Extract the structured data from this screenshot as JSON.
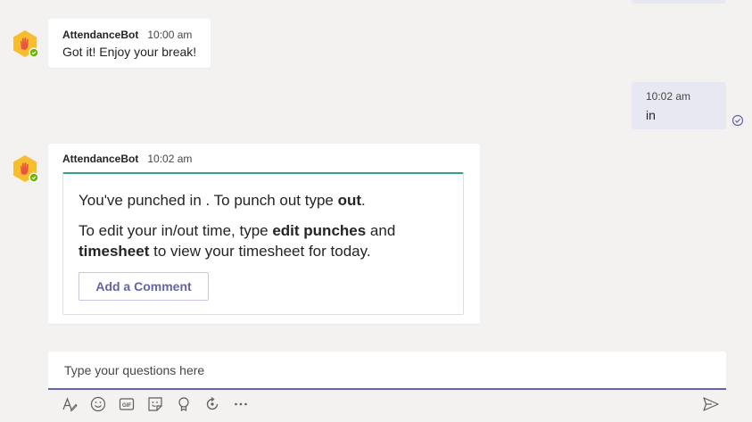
{
  "messages": [
    {
      "sender": "AttendanceBot",
      "time": "10:00 am",
      "text": "Got it! Enjoy your break!"
    },
    {
      "time": "10:02 am",
      "text": "in"
    },
    {
      "sender": "AttendanceBot",
      "time": "10:02 am",
      "card": {
        "line1_pre": "You've punched in . To punch out type ",
        "line1_bold": "out",
        "line1_post": ".",
        "line2_pre": "To edit your in/out time, type ",
        "line2_bold1": "edit punches",
        "line2_mid": " and",
        "line2_bold2": "timesheet",
        "line2_post": " to view your timesheet for today.",
        "button_label": "Add a Comment"
      }
    }
  ],
  "compose": {
    "placeholder": "Type your questions here"
  },
  "toolbar": {
    "icons": [
      "format-icon",
      "emoji-icon",
      "gif-icon",
      "sticker-icon",
      "praise-icon",
      "loop-icon",
      "more-options-icon",
      "send-icon"
    ]
  },
  "colors": {
    "accent": "#6264a7",
    "card_accent": "#33a08b",
    "avatar": "#f7bd2f",
    "status_available": "#6bb700"
  }
}
